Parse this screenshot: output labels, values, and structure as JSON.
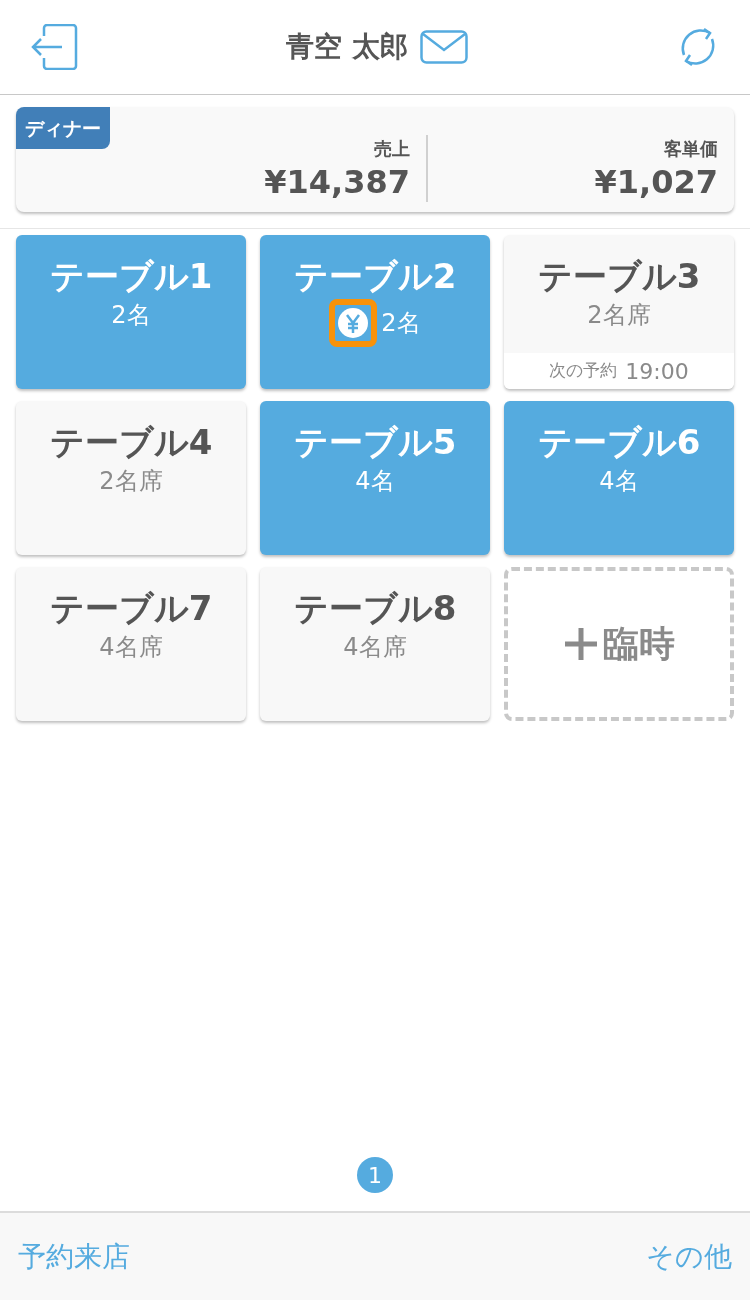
{
  "header": {
    "title": "青空 太郎"
  },
  "summary": {
    "shift": "ディナー",
    "metrics": [
      {
        "label": "売上",
        "value": "¥14,387"
      },
      {
        "label": "客単価",
        "value": "¥1,027"
      }
    ]
  },
  "tables": [
    {
      "kind": "table",
      "name": "テーブル1",
      "guests": "2名",
      "occupied": true,
      "paid": false
    },
    {
      "kind": "table",
      "name": "テーブル2",
      "guests": "2名",
      "occupied": true,
      "paid": true
    },
    {
      "kind": "table",
      "name": "テーブル3",
      "guests": "2名席",
      "occupied": false,
      "paid": false,
      "next_label": "次の予約",
      "next_time": "19:00"
    },
    {
      "kind": "table",
      "name": "テーブル4",
      "guests": "2名席",
      "occupied": false,
      "paid": false
    },
    {
      "kind": "table",
      "name": "テーブル5",
      "guests": "4名",
      "occupied": true,
      "paid": false
    },
    {
      "kind": "table",
      "name": "テーブル6",
      "guests": "4名",
      "occupied": true,
      "paid": false
    },
    {
      "kind": "table",
      "name": "テーブル7",
      "guests": "4名席",
      "occupied": false,
      "paid": false
    },
    {
      "kind": "table",
      "name": "テーブル8",
      "guests": "4名席",
      "occupied": false,
      "paid": false
    },
    {
      "kind": "add",
      "name": "臨時"
    }
  ],
  "pagination": [
    {
      "label": "1",
      "selected": true
    }
  ],
  "footer": {
    "left": "予約来店",
    "right": "その他"
  }
}
